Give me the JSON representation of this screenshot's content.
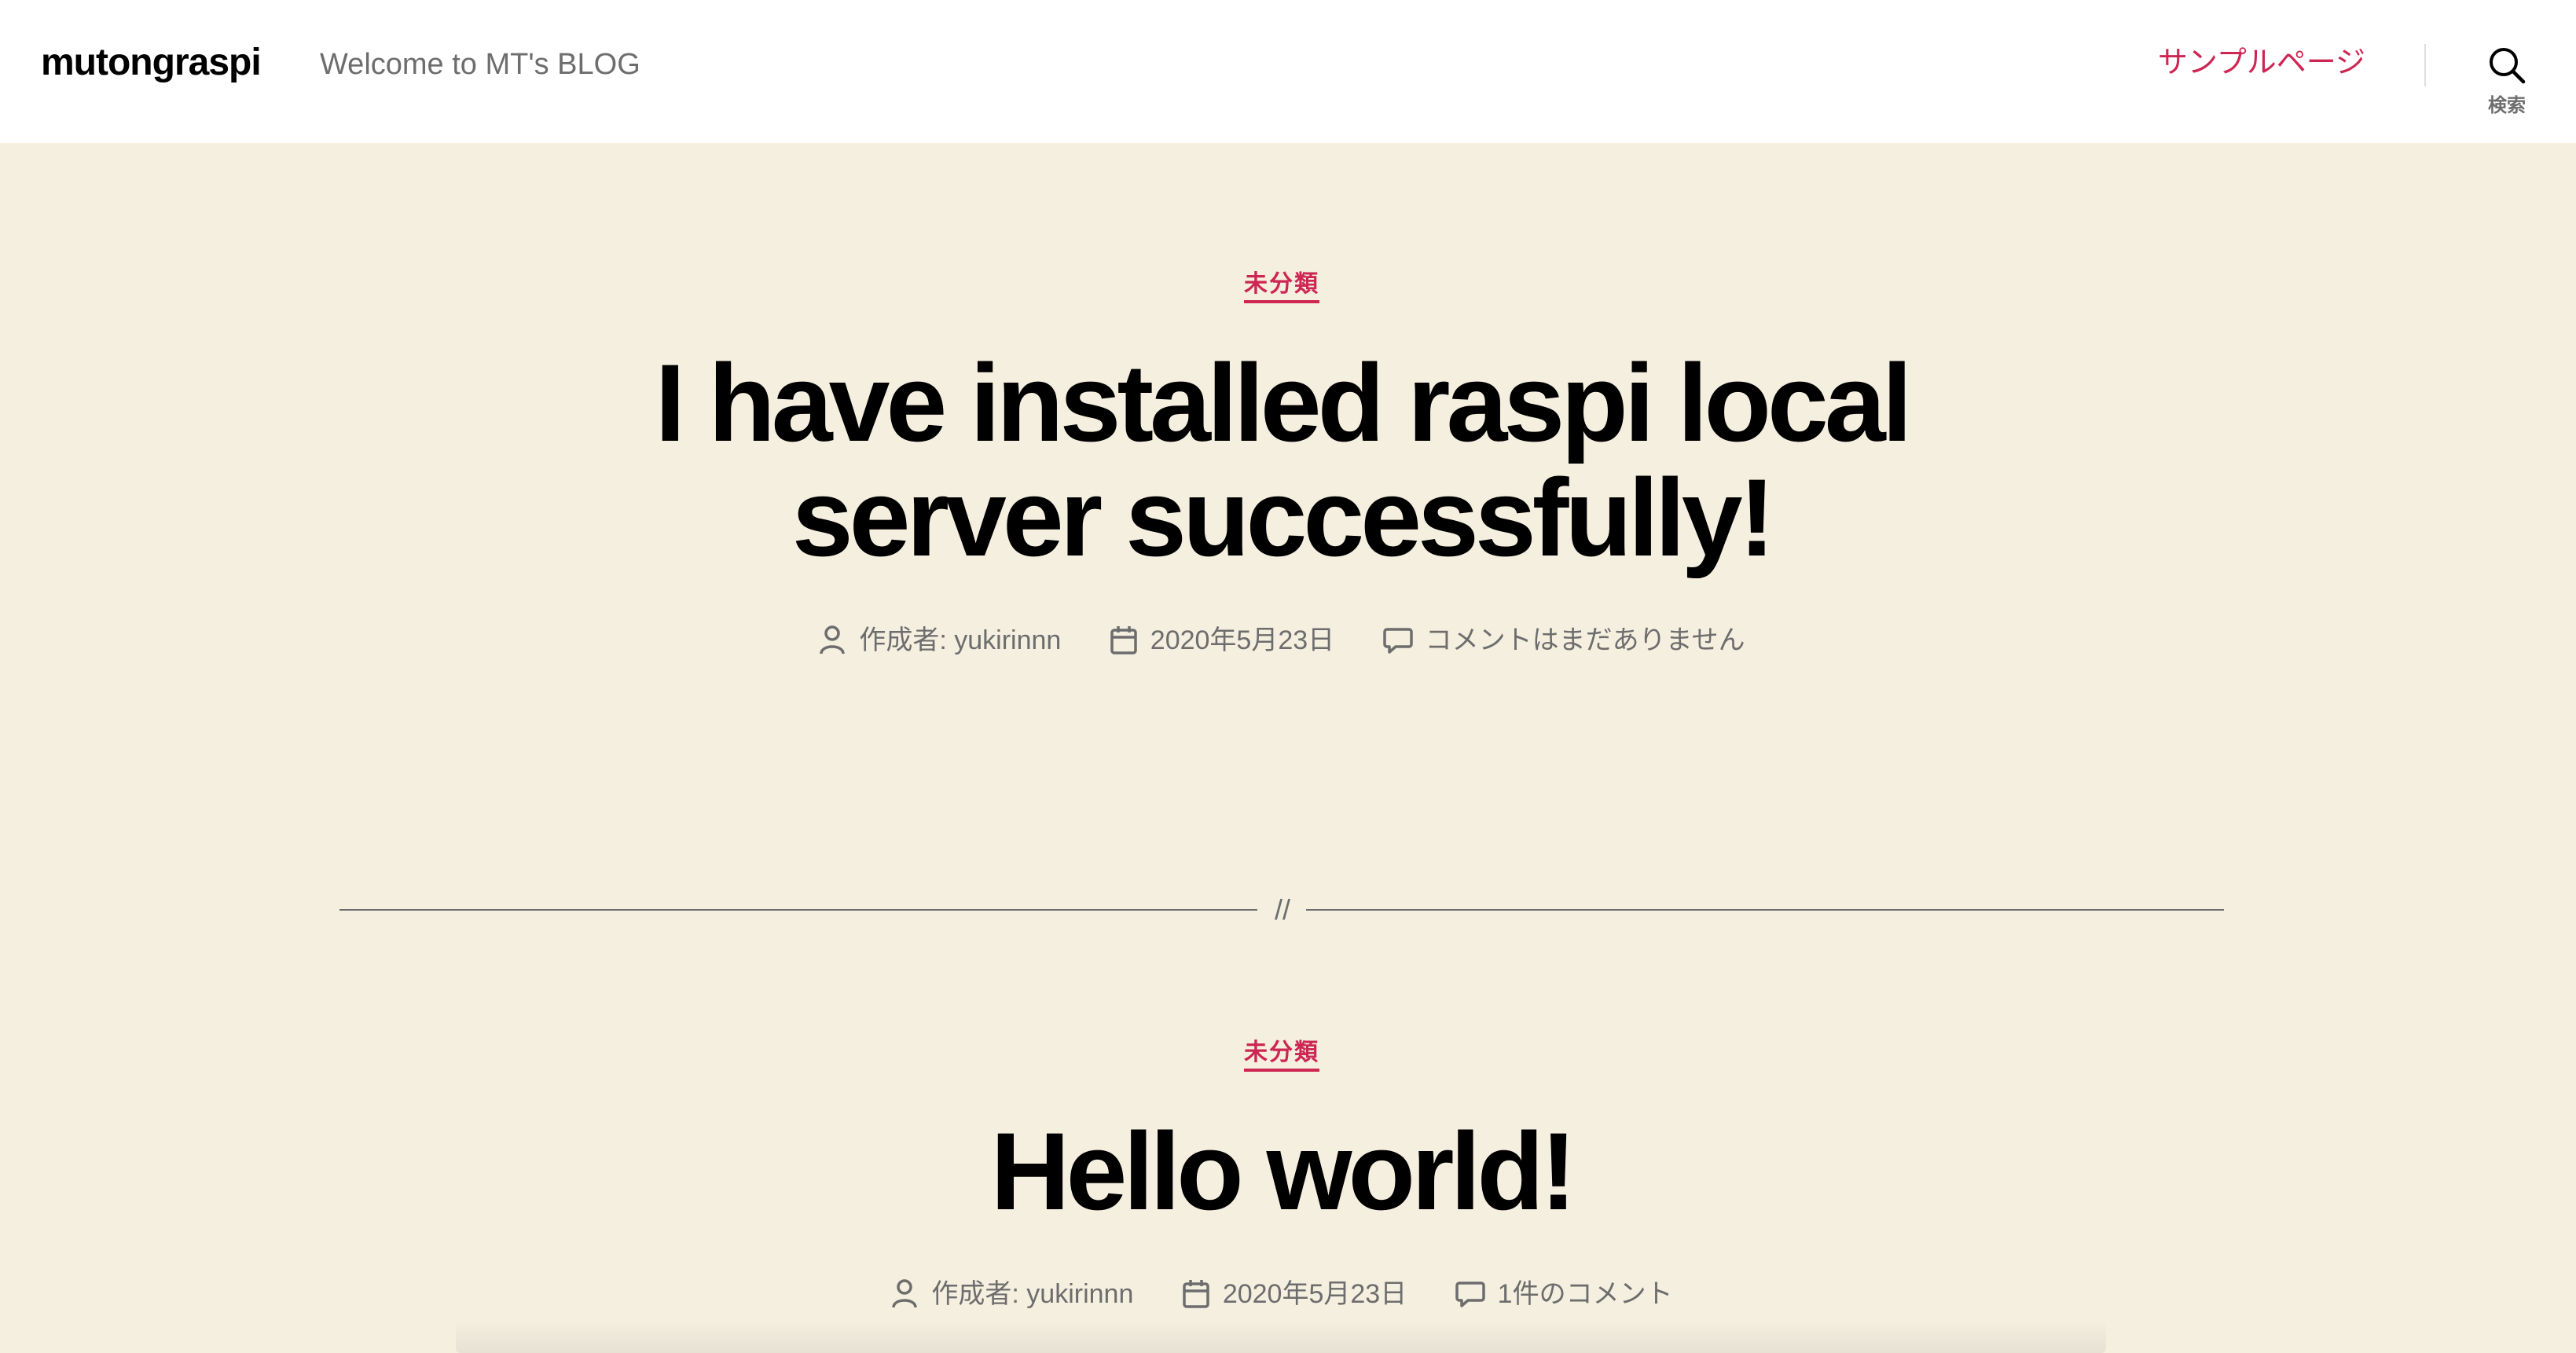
{
  "header": {
    "site_title": "mutongraspi",
    "site_description": "Welcome to MT's BLOG",
    "menu_item": "サンプルページ",
    "search_label": "検索",
    "accent_color": "#cd2653"
  },
  "posts": [
    {
      "category": "未分類",
      "title_line1": "I have installed raspi local",
      "title_line2": "server successfully!",
      "author": "作成者: yukirinnn",
      "date": "2020年5月23日",
      "comments": "コメントはまだありません"
    },
    {
      "category": "未分類",
      "title_line1": "Hello world!",
      "author": "作成者: yukirinnn",
      "date": "2020年5月23日",
      "comments": "1件のコメント"
    }
  ],
  "separator": "//",
  "icons": {
    "search": "search-icon",
    "author": "user-icon",
    "date": "calendar-icon",
    "comments": "comment-icon"
  }
}
